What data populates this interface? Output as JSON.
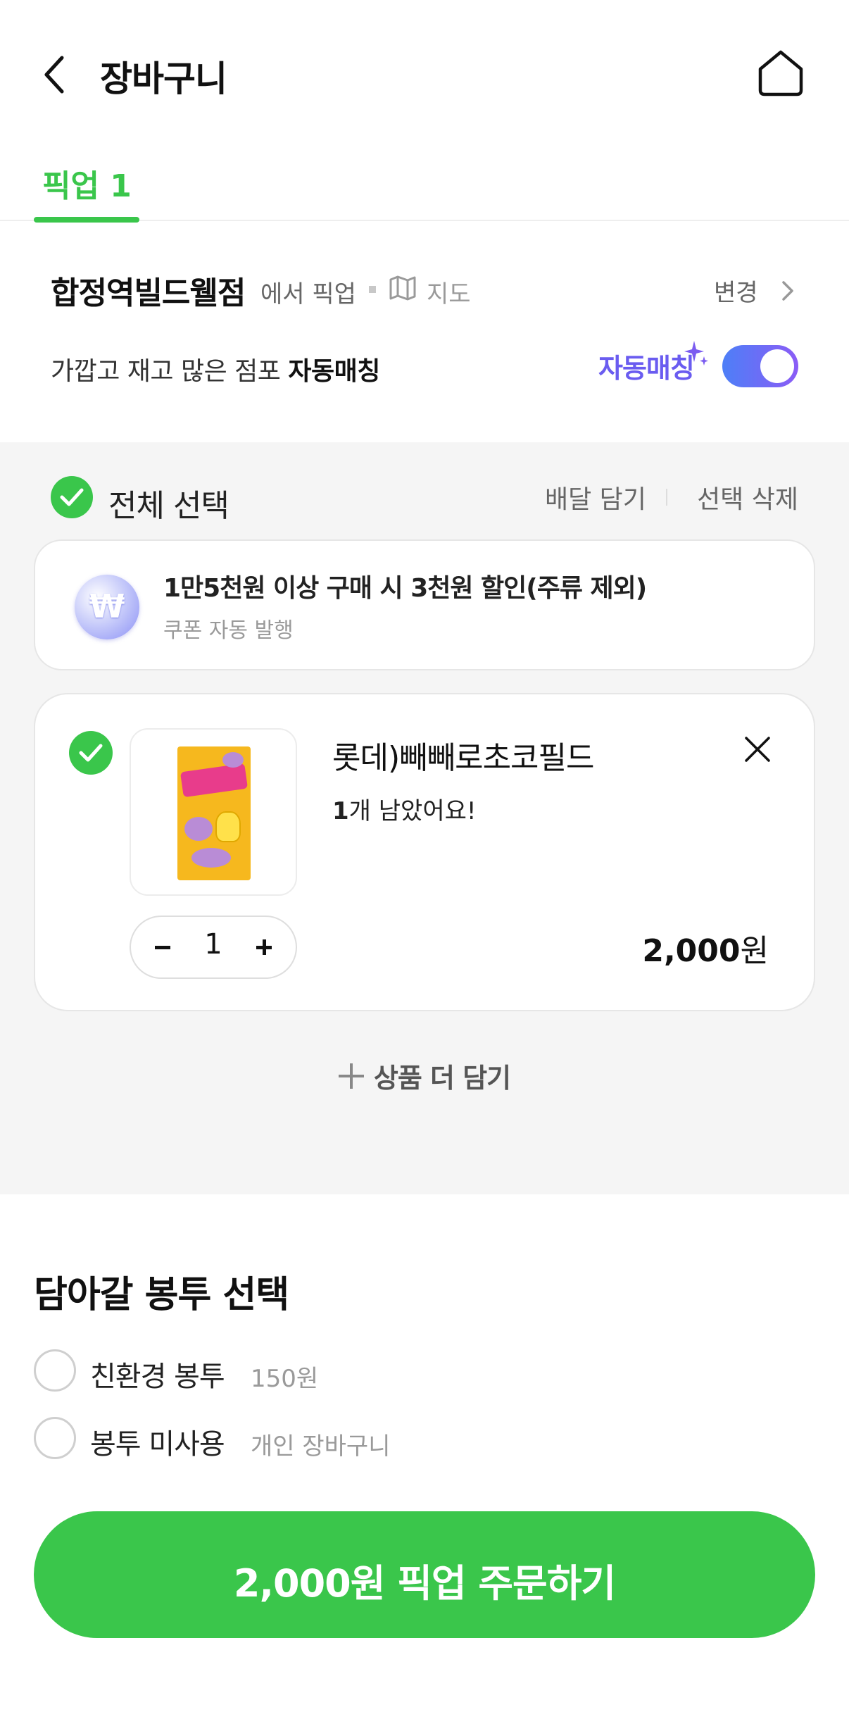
{
  "header": {
    "title": "장바구니",
    "back_icon": "chevron-left-icon",
    "home_icon": "home-icon"
  },
  "tabs": [
    {
      "label": "픽업 1",
      "active": true
    }
  ],
  "store": {
    "name": "합정역빌드웰점",
    "suffix": "에서 픽업",
    "map_label": "지도",
    "change_label": "변경"
  },
  "auto_match": {
    "description_prefix": "가깝고 재고 많은 점포 ",
    "description_bold": "자동매칭",
    "badge": "자동매칭",
    "enabled": true
  },
  "cart": {
    "select_all_label": "전체 선택",
    "delivery_add_label": "배달 담기",
    "delete_selected_label": "선택 삭제",
    "coupon": {
      "title": "1만5천원 이상 구매 시 3천원 할인(주류 제외)",
      "subtitle": "쿠폰 자동 발행",
      "icon_symbol": "₩"
    },
    "items": [
      {
        "name": "롯데)빼빼로초코필드",
        "stock_count": "1",
        "stock_suffix": "개 남았어요!",
        "quantity": "1",
        "price_number": "2,000",
        "price_unit": "원",
        "checked": true
      }
    ],
    "add_more_label": "상품 더 담기"
  },
  "bag": {
    "title": "담아갈 봉투 선택",
    "options": [
      {
        "label": "친환경 봉투",
        "sub": "150원"
      },
      {
        "label": "봉투 미사용",
        "sub": "개인 장바구니"
      }
    ]
  },
  "order_button": {
    "label": "2,000원 픽업 주문하기"
  },
  "colors": {
    "brand_green": "#3ac64b",
    "auto_match_purple": "#6a5cf0",
    "toggle_gradient_start": "#4d7ff7",
    "toggle_gradient_end": "#8b5cf6"
  }
}
